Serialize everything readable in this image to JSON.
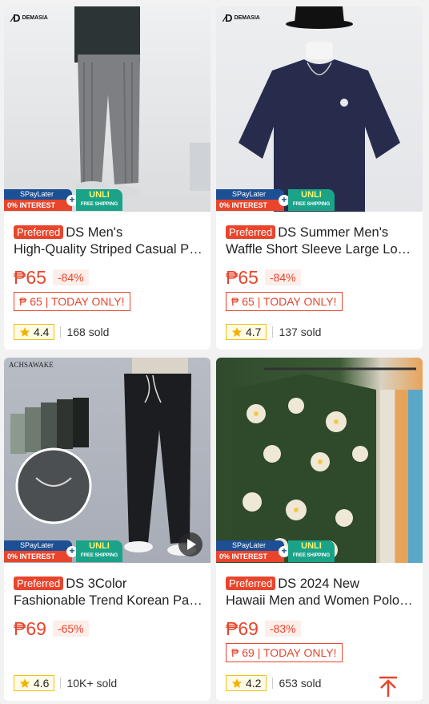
{
  "badges": {
    "spaylater": "SPayLater",
    "interest": "0% INTEREST",
    "unli": "UNLI",
    "free_shipping": "FREE SHIPPING"
  },
  "colors": {
    "accent": "#e8452c",
    "badge_blue": "#1d4f95",
    "badge_green": "#1aa389",
    "star": "#f0b400"
  },
  "products": [
    {
      "brand": "DEMASIA",
      "tag": "Preferred",
      "title_line1": "DS Men's",
      "title_line2": "High-Quality Striped Casual Pants",
      "price": "₱65",
      "discount": "-84%",
      "today_only": "₱ 65 | TODAY ONLY!",
      "rating": "4.4",
      "sold": "168 sold"
    },
    {
      "brand": "DEMASIA",
      "tag": "Preferred",
      "title_line1": "DS Summer Men's",
      "title_line2": "Waffle Short Sleeve Large Loose T-shirt",
      "price": "₱65",
      "discount": "-84%",
      "today_only": "₱ 65 | TODAY ONLY!",
      "rating": "4.7",
      "sold": "137 sold"
    },
    {
      "brand": "ACHSAWAKE",
      "tag": "Preferred",
      "title_line1": "DS 3Color",
      "title_line2": "Fashionable Trend Korean Pants",
      "price": "₱69",
      "discount": "-65%",
      "today_only": "",
      "rating": "4.6",
      "sold": "10K+ sold"
    },
    {
      "brand": "",
      "tag": "Preferred",
      "title_line1": "DS 2024 New",
      "title_line2": "Hawaii Men and Women Polo Shirt",
      "price": "₱69",
      "discount": "-83%",
      "today_only": "₱ 69 | TODAY ONLY!",
      "rating": "4.2",
      "sold": "653 sold"
    }
  ],
  "icons": {
    "star": "star-icon",
    "back_to_top": "arrow-up-icon",
    "play": "play-icon"
  }
}
